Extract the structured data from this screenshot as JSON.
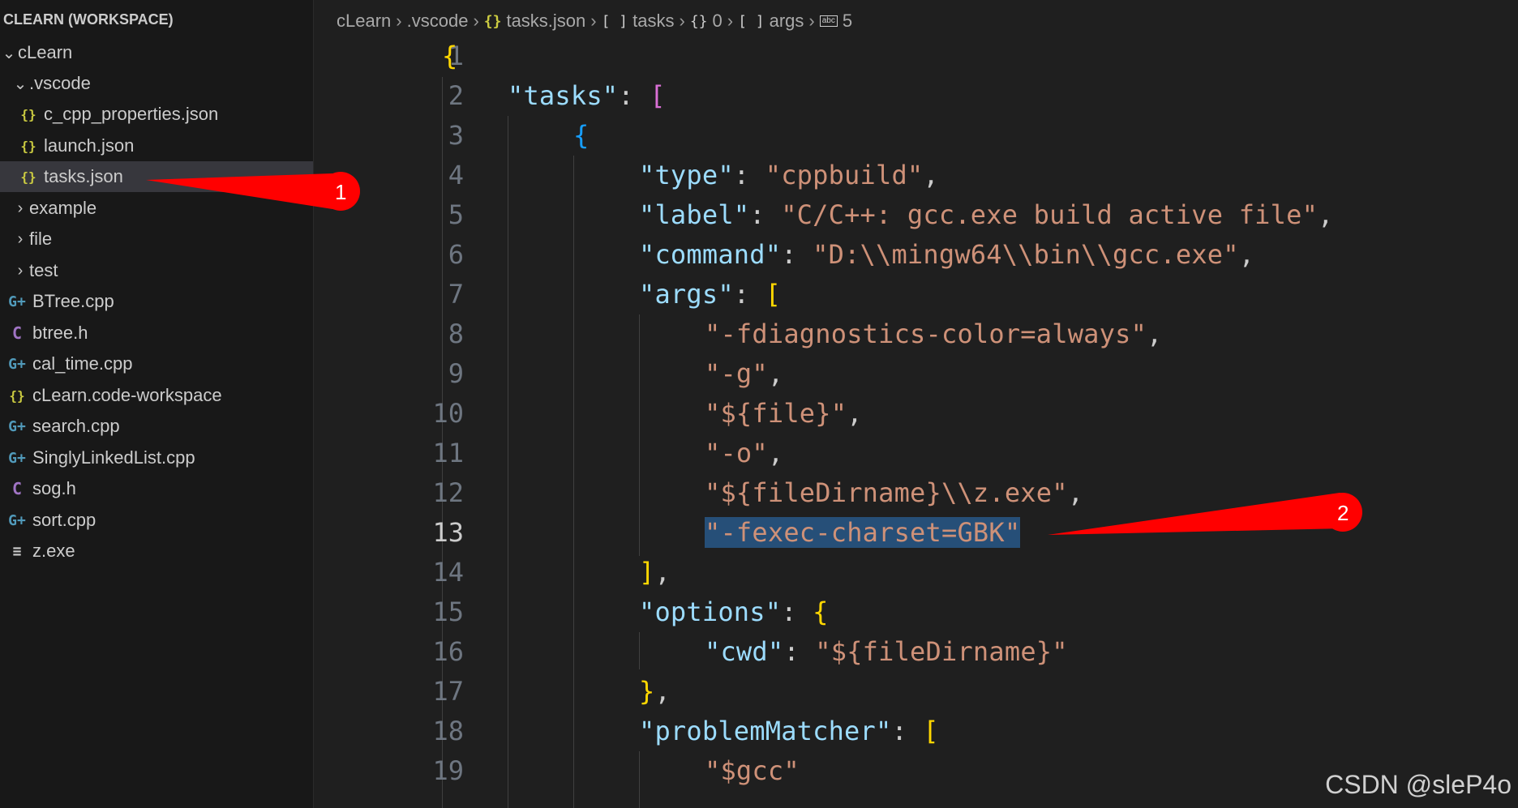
{
  "sidebar": {
    "title": "CLEARN (WORKSPACE)",
    "root_folder": "cLearn",
    "vscode_folder": ".vscode",
    "vscode_files": [
      "c_cpp_properties.json",
      "launch.json",
      "tasks.json"
    ],
    "folders": [
      "example",
      "file",
      "test"
    ],
    "files": [
      {
        "name": "BTree.cpp",
        "icon": "cpp-icon"
      },
      {
        "name": "btree.h",
        "icon": "c-header-icon"
      },
      {
        "name": "cal_time.cpp",
        "icon": "cpp-icon"
      },
      {
        "name": "cLearn.code-workspace",
        "icon": "json-braces-icon"
      },
      {
        "name": "search.cpp",
        "icon": "cpp-icon"
      },
      {
        "name": "SinglyLinkedList.cpp",
        "icon": "cpp-icon"
      },
      {
        "name": "sog.h",
        "icon": "c-header-icon"
      },
      {
        "name": "sort.cpp",
        "icon": "cpp-icon"
      },
      {
        "name": "z.exe",
        "icon": "binary-file-icon"
      }
    ],
    "selected": "tasks.json"
  },
  "breadcrumb": {
    "workspace": "cLearn",
    "folder": ".vscode",
    "file": "tasks.json",
    "seg_tasks_icon": "[ ]",
    "seg_tasks": "tasks",
    "seg_index_icon": "{}",
    "seg_index": "0",
    "seg_args_icon": "[ ]",
    "seg_args": "args",
    "seg_item": "5"
  },
  "editor": {
    "line_numbers": [
      "1",
      "2",
      "3",
      "4",
      "5",
      "6",
      "7",
      "8",
      "9",
      "10",
      "11",
      "12",
      "13",
      "14",
      "15",
      "16",
      "17",
      "18",
      "19"
    ],
    "active_line": "13",
    "code": {
      "l1_open": "{",
      "l2_key": "\"tasks\"",
      "l2_colon": ": ",
      "l2_bracket": "[",
      "l3_open": "{",
      "l4_key": "\"type\"",
      "l4_colon": ": ",
      "l4_val": "\"cppbuild\"",
      "l4_comma": ",",
      "l5_key": "\"label\"",
      "l5_colon": ": ",
      "l5_val": "\"C/C++: gcc.exe build active file\"",
      "l5_comma": ",",
      "l6_key": "\"command\"",
      "l6_colon": ": ",
      "l6_val": "\"D:\\\\mingw64\\\\bin\\\\gcc.exe\"",
      "l6_comma": ",",
      "l7_key": "\"args\"",
      "l7_colon": ": ",
      "l7_bracket": "[",
      "l8_val": "\"-fdiagnostics-color=always\"",
      "l8_comma": ",",
      "l9_val": "\"-g\"",
      "l9_comma": ",",
      "l10_val": "\"${file}\"",
      "l10_comma": ",",
      "l11_val": "\"-o\"",
      "l11_comma": ",",
      "l12_val": "\"${fileDirname}\\\\z.exe\"",
      "l12_comma": ",",
      "l13_val": "\"-fexec-charset=GBK\"",
      "l14_close": "]",
      "l14_comma": ",",
      "l15_key": "\"options\"",
      "l15_colon": ": ",
      "l15_open": "{",
      "l16_key": "\"cwd\"",
      "l16_colon": ": ",
      "l16_val": "\"${fileDirname}\"",
      "l17_close": "}",
      "l17_comma": ",",
      "l18_key": "\"problemMatcher\"",
      "l18_colon": ": ",
      "l18_bracket": "[",
      "l19_val": "\"$gcc\""
    }
  },
  "annotations": {
    "callout_1": "1",
    "callout_2": "2",
    "color": "#ff0000"
  },
  "watermark": "CSDN @sleP4o"
}
